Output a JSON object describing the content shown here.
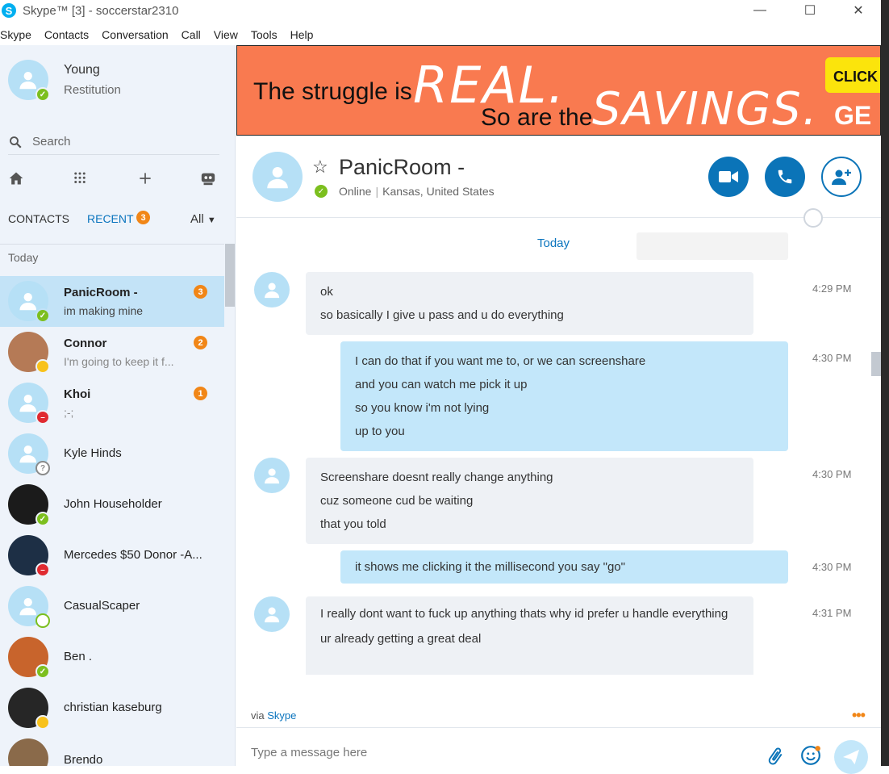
{
  "window": {
    "title": "Skype™ [3] - soccerstar2310",
    "logo_letter": "S",
    "minimize": "—",
    "maximize": "☐",
    "close": "✕"
  },
  "menu": [
    "Skype",
    "Contacts",
    "Conversation",
    "Call",
    "View",
    "Tools",
    "Help"
  ],
  "profile": {
    "name": "Young",
    "mood": "Restitution"
  },
  "search": {
    "label": "Search"
  },
  "tabs": {
    "contacts": "CONTACTS",
    "recent": "RECENT",
    "recent_count": "3",
    "filter": "All"
  },
  "section": {
    "today": "Today"
  },
  "contacts": [
    {
      "name": "PanicRoom -",
      "mood": "im making mine",
      "badge": "3",
      "status": "online",
      "bold": true
    },
    {
      "name": "Connor",
      "mood": "I'm going to keep it f...",
      "badge": "2",
      "status": "away",
      "bold": true
    },
    {
      "name": "Khoi",
      "mood": ";-;",
      "badge": "1",
      "status": "busy",
      "bold": true
    },
    {
      "name": "Kyle Hinds",
      "mood": "",
      "badge": "",
      "status": "unknown",
      "bold": false
    },
    {
      "name": "John Householder",
      "mood": "",
      "badge": "",
      "status": "online",
      "bold": false
    },
    {
      "name": "Mercedes $50 Donor -A...",
      "mood": "",
      "badge": "",
      "status": "busy",
      "bold": false
    },
    {
      "name": "CasualScaper",
      "mood": "",
      "badge": "",
      "status": "offline",
      "bold": false
    },
    {
      "name": "Ben .",
      "mood": "",
      "badge": "",
      "status": "online",
      "bold": false
    },
    {
      "name": "christian kaseburg",
      "mood": "",
      "badge": "",
      "status": "away",
      "bold": false
    },
    {
      "name": "Brendo",
      "mood": "",
      "badge": "",
      "status": "away",
      "bold": false
    }
  ],
  "ad": {
    "line1": "The struggle is",
    "real": "REAL.",
    "line2": "So are the",
    "savings": "SAVINGS.",
    "cta": "CLICK T",
    "tail": "GE"
  },
  "conversation": {
    "name": "PanicRoom -",
    "status": "Online",
    "location": "Kansas, United States",
    "day": "Today",
    "messages": [
      {
        "dir": "in",
        "time": "4:29 PM",
        "lines": [
          "ok",
          "so basically I give u pass and u do everything"
        ]
      },
      {
        "dir": "out",
        "time": "4:30 PM",
        "lines": [
          "I can do that if you want me to, or we can screenshare",
          "and you can watch me pick it up",
          "so you know i'm not lying",
          "up to you"
        ]
      },
      {
        "dir": "in",
        "time": "4:30 PM",
        "lines": [
          "Screenshare doesnt really change anything",
          "cuz someone cud be waiting",
          "that you told"
        ]
      },
      {
        "dir": "out",
        "time": "4:30 PM",
        "lines": [
          "it shows me clicking it the millisecond you say \"go\""
        ]
      },
      {
        "dir": "in",
        "time": "4:31 PM",
        "lines": [
          "I really dont want to fuck up anything thats why id prefer u handle everything",
          "ur already getting a great deal"
        ]
      }
    ],
    "via_prefix": "via",
    "via_link": "Skype",
    "more": "•••"
  },
  "composer": {
    "placeholder": "Type a message here"
  },
  "colors": {
    "accent": "#0b74b8",
    "badge": "#f18617",
    "online": "#7cbf1e",
    "busy": "#e02a30",
    "away": "#f8c21c",
    "ad_bg": "#f97a50"
  }
}
